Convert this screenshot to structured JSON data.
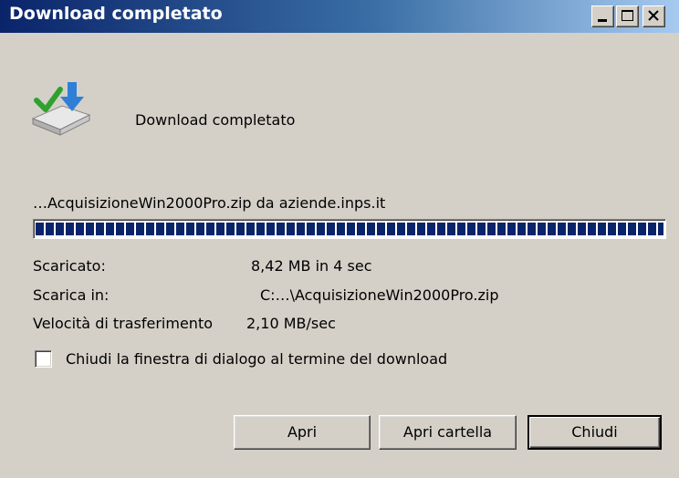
{
  "window": {
    "title": "Download completato"
  },
  "header": {
    "icon": "download-complete-icon",
    "message": "Download completato"
  },
  "download": {
    "file_line": "…AcquisizioneWin2000Pro.zip da aziende.inps.it",
    "progress_fraction": 1.0,
    "labels": {
      "downloaded": "Scaricato:",
      "save_to": "Scarica in:",
      "speed": "Velocità di trasferimento"
    },
    "values": {
      "downloaded": "8,42 MB in 4 sec",
      "save_to": "C:…\\AcquisizioneWin2000Pro.zip",
      "speed": "2,10 MB/sec"
    }
  },
  "options": {
    "close_on_complete_label": "Chiudi la finestra di dialogo al termine del download",
    "close_on_complete_checked": false
  },
  "buttons": {
    "open": "Apri",
    "open_folder": "Apri cartella",
    "close": "Chiudi"
  }
}
